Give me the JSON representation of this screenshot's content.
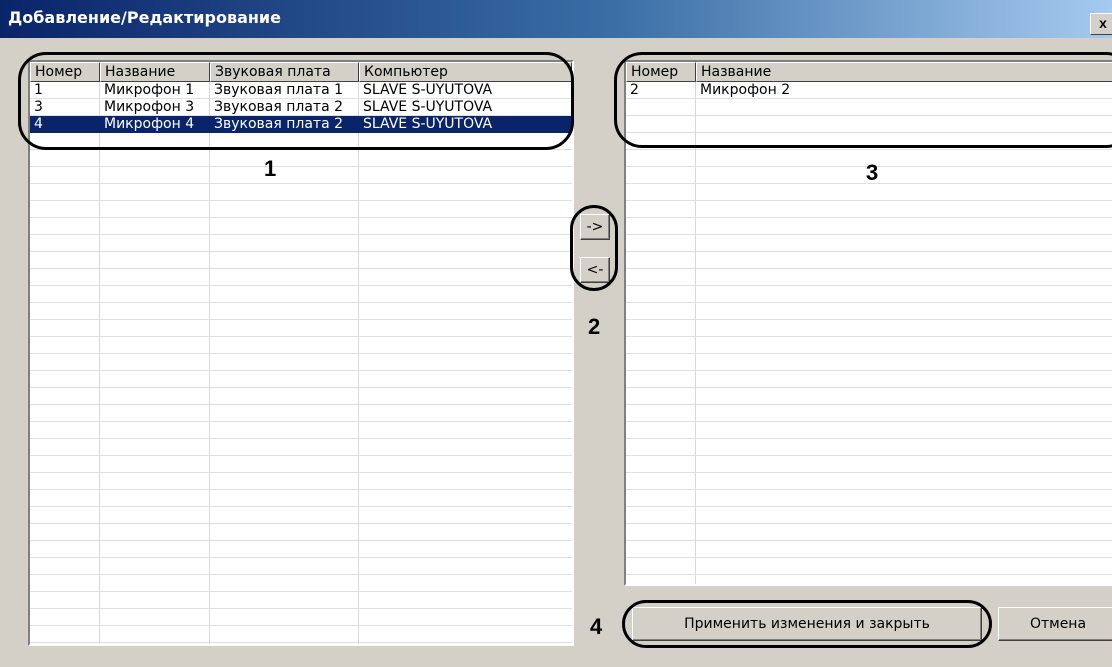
{
  "window": {
    "title": "Добавление/Редактирование",
    "close_label": "x"
  },
  "left_list": {
    "columns": [
      "Номер",
      "Название",
      "Звуковая плата",
      "Компьютер"
    ],
    "rows": [
      [
        "1",
        "Микрофон 1",
        "Звуковая плата 1",
        "SLAVE S-UYUTOVA"
      ],
      [
        "3",
        "Микрофон 3",
        "Звуковая плата 2",
        "SLAVE S-UYUTOVA"
      ],
      [
        "4",
        "Микрофон 4",
        "Звуковая плата 2",
        "SLAVE S-UYUTOVA"
      ]
    ],
    "selected_row": 2
  },
  "right_list": {
    "columns": [
      "Номер",
      "Название"
    ],
    "rows": [
      [
        "2",
        "Микрофон 2"
      ]
    ]
  },
  "buttons": {
    "add": "->",
    "remove": "<-",
    "apply": "Применить изменения и закрыть",
    "cancel": "Отмена"
  },
  "annotations": {
    "n1": "1",
    "n2": "2",
    "n3": "3",
    "n4": "4"
  },
  "colors": {
    "selection": "#0a246a",
    "title_start": "#0a246a",
    "title_end": "#a6caf0",
    "face": "#d4d0c8"
  }
}
